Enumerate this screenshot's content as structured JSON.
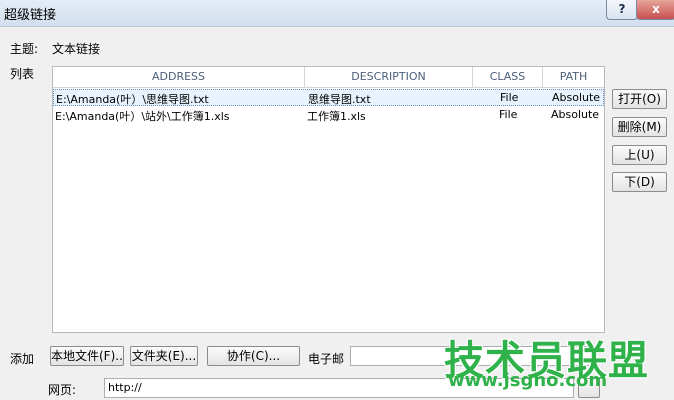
{
  "window": {
    "title": "超级链接",
    "help_label": "?",
    "close_label": "x"
  },
  "subject": {
    "label": "主题:",
    "value": "文本链接"
  },
  "list": {
    "label": "列表",
    "columns": [
      "ADDRESS",
      "DESCRIPTION",
      "CLASS",
      "PATH"
    ],
    "rows": [
      {
        "address": "E:\\Amanda(叶）\\思维导图.txt",
        "description": "思维导图.txt",
        "class": "File",
        "path": "Absolute"
      },
      {
        "address": "E:\\Amanda(叶）\\站外\\工作簿1.xls",
        "description": "工作簿1.xls",
        "class": "File",
        "path": "Absolute"
      }
    ]
  },
  "side_buttons": {
    "open": "打开(O)",
    "delete": "删除(M)",
    "up": "上(U)",
    "down": "下(D)"
  },
  "add": {
    "label": "添加",
    "local_file": "本地文件(F)...",
    "folder": "文件夹(E)...",
    "action": "协作(C)...",
    "email_label": "电子邮",
    "email_value": ""
  },
  "web": {
    "label": "网页:",
    "value": "http://"
  },
  "watermark": {
    "title": "技术员联盟",
    "url": "www.jsgho.com"
  }
}
